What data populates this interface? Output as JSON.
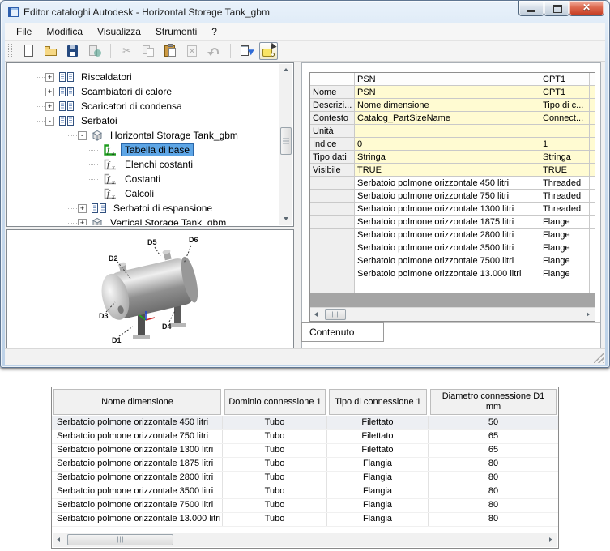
{
  "window": {
    "title": "Editor cataloghi Autodesk - Horizontal Storage Tank_gbm",
    "controls": [
      {
        "name": "minimize-button"
      },
      {
        "name": "restore-button"
      },
      {
        "name": "close-button"
      }
    ]
  },
  "menu": {
    "items": [
      {
        "label": "File",
        "underline": true,
        "key": "file"
      },
      {
        "label": "Modifica",
        "underline": true,
        "key": "modifica"
      },
      {
        "label": "Visualizza",
        "underline": true,
        "key": "visualizza"
      },
      {
        "label": "Strumenti",
        "underline": true,
        "key": "strumenti"
      },
      {
        "label": "?",
        "underline": false,
        "key": "help"
      }
    ]
  },
  "toolbar": {
    "buttons": [
      {
        "name": "new",
        "state": "normal"
      },
      {
        "name": "open",
        "state": "normal"
      },
      {
        "name": "save",
        "state": "normal"
      },
      {
        "name": "publish",
        "state": "disabled"
      },
      {
        "sep": true
      },
      {
        "name": "cut",
        "state": "disabled"
      },
      {
        "name": "copy",
        "state": "disabled"
      },
      {
        "name": "paste",
        "state": "normal"
      },
      {
        "name": "clear",
        "state": "disabled"
      },
      {
        "name": "undo",
        "state": "disabled"
      },
      {
        "sep": true
      },
      {
        "name": "edit-sizes",
        "state": "normal"
      },
      {
        "name": "validate",
        "state": "pressed"
      }
    ]
  },
  "tree": {
    "items": [
      {
        "label": "Riscaldatori",
        "level": 0,
        "expander": "plus",
        "icon": "book",
        "selected": false
      },
      {
        "label": "Scambiatori di calore",
        "level": 0,
        "expander": "plus",
        "icon": "book",
        "selected": false
      },
      {
        "label": "Scaricatori di condensa",
        "level": 0,
        "expander": "plus",
        "icon": "book",
        "selected": false
      },
      {
        "label": "Serbatoi",
        "level": 0,
        "expander": "minus",
        "icon": "book",
        "selected": false
      },
      {
        "label": "Horizontal Storage Tank_gbm",
        "level": 1,
        "expander": "minus",
        "icon": "cube",
        "selected": false
      },
      {
        "label": "Tabella di base",
        "level": 2,
        "expander": "none",
        "icon": "fx-green",
        "selected": true
      },
      {
        "label": "Elenchi costanti",
        "level": 2,
        "expander": "none",
        "icon": "fx",
        "selected": false
      },
      {
        "label": "Costanti",
        "level": 2,
        "expander": "none",
        "icon": "fx",
        "selected": false
      },
      {
        "label": "Calcoli",
        "level": 2,
        "expander": "none",
        "icon": "fx",
        "selected": false
      },
      {
        "label": "Serbatoi di espansione",
        "level": 1,
        "expander": "plus",
        "icon": "book",
        "selected": false
      },
      {
        "label": "Vertical Storage Tank_gbm",
        "level": 1,
        "expander": "plus",
        "icon": "cube",
        "selected": false
      }
    ]
  },
  "preview": {
    "labels": [
      "D1",
      "D2",
      "D3",
      "D4",
      "D5",
      "D6"
    ]
  },
  "property_grid": {
    "columns": [
      "",
      "PSN",
      "CPT1"
    ],
    "property_rows": [
      {
        "label": "Nome",
        "psn": "PSN",
        "cpt1": "CPT1"
      },
      {
        "label": "Descrizi...",
        "psn": "Nome dimensione",
        "cpt1": "Tipo di c..."
      },
      {
        "label": "Contesto",
        "psn": "Catalog_PartSizeName",
        "cpt1": "Connect..."
      },
      {
        "label": "Unità",
        "psn": "",
        "cpt1": ""
      },
      {
        "label": "Indice",
        "psn": "0",
        "cpt1": "1"
      },
      {
        "label": "Tipo dati",
        "psn": "Stringa",
        "cpt1": "Stringa"
      },
      {
        "label": "Visibile",
        "psn": "TRUE",
        "cpt1": "TRUE"
      }
    ],
    "size_rows": [
      {
        "psn": "Serbatoio polmone orizzontale 450 litri",
        "cpt1": "Threaded"
      },
      {
        "psn": "Serbatoio polmone orizzontale 750 litri",
        "cpt1": "Threaded"
      },
      {
        "psn": "Serbatoio polmone orizzontale 1300 litri",
        "cpt1": "Threaded"
      },
      {
        "psn": "Serbatoio polmone orizzontale 1875 litri",
        "cpt1": "Flange"
      },
      {
        "psn": "Serbatoio polmone orizzontale 2800 litri",
        "cpt1": "Flange"
      },
      {
        "psn": "Serbatoio polmone orizzontale 3500 litri",
        "cpt1": "Flange"
      },
      {
        "psn": "Serbatoio polmone orizzontale 7500 litri",
        "cpt1": "Flange"
      },
      {
        "psn": "Serbatoio polmone orizzontale 13.000 litri",
        "cpt1": "Flange"
      }
    ],
    "tab_label": "Contenuto"
  },
  "size_table": {
    "headers": [
      "Nome dimensione",
      "Dominio connessione 1",
      "Tipo di connessione 1",
      "Diametro connessione D1\nmm"
    ],
    "rows": [
      [
        "Serbatoio polmone orizzontale 450 litri",
        "Tubo",
        "Filettato",
        "50"
      ],
      [
        "Serbatoio polmone orizzontale 750 litri",
        "Tubo",
        "Filettato",
        "65"
      ],
      [
        "Serbatoio polmone orizzontale 1300 litri",
        "Tubo",
        "Filettato",
        "65"
      ],
      [
        "Serbatoio polmone orizzontale 1875 litri",
        "Tubo",
        "Flangia",
        "80"
      ],
      [
        "Serbatoio polmone orizzontale 2800 litri",
        "Tubo",
        "Flangia",
        "80"
      ],
      [
        "Serbatoio polmone orizzontale 3500 litri",
        "Tubo",
        "Flangia",
        "80"
      ],
      [
        "Serbatoio polmone orizzontale 7500 litri",
        "Tubo",
        "Flangia",
        "80"
      ],
      [
        "Serbatoio polmone orizzontale 13.000 litri",
        "Tubo",
        "Flangia",
        "80"
      ]
    ]
  }
}
